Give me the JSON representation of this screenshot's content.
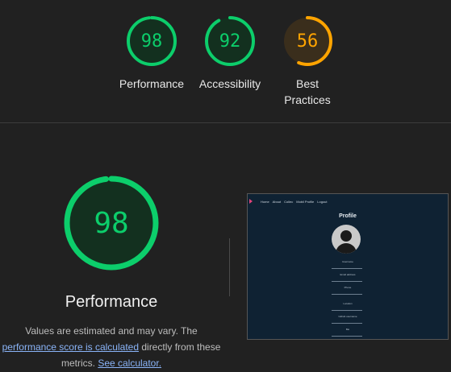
{
  "categories": [
    {
      "label": "Performance",
      "score": "98",
      "fraction": 0.98,
      "color": "#0cce6b",
      "bg": "#13301f"
    },
    {
      "label": "Accessibility",
      "score": "92",
      "fraction": 0.92,
      "color": "#0cce6b",
      "bg": "#13301f"
    },
    {
      "label_line1": "Best",
      "label_line2": "Practices",
      "score": "56",
      "fraction": 0.56,
      "color": "#ffa400",
      "bg": "#3a2e1c"
    }
  ],
  "detail": {
    "score": "98",
    "fraction": 0.98,
    "color": "#0cce6b",
    "bg": "#13301f",
    "title": "Performance",
    "desc_prefix": "Values are estimated and may vary. The",
    "link1": "performance score is calculated",
    "desc_mid": " directly from these",
    "desc_metrics": "metrics. ",
    "link2": "See calculator."
  },
  "screenshot": {
    "nav": [
      "Home",
      "About",
      "Collec",
      "Mobil Profile",
      "Logout"
    ],
    "title": "Profile",
    "fields": [
      "Username",
      "Email address",
      "Phone",
      "Location",
      "Github username",
      "Bio"
    ]
  }
}
